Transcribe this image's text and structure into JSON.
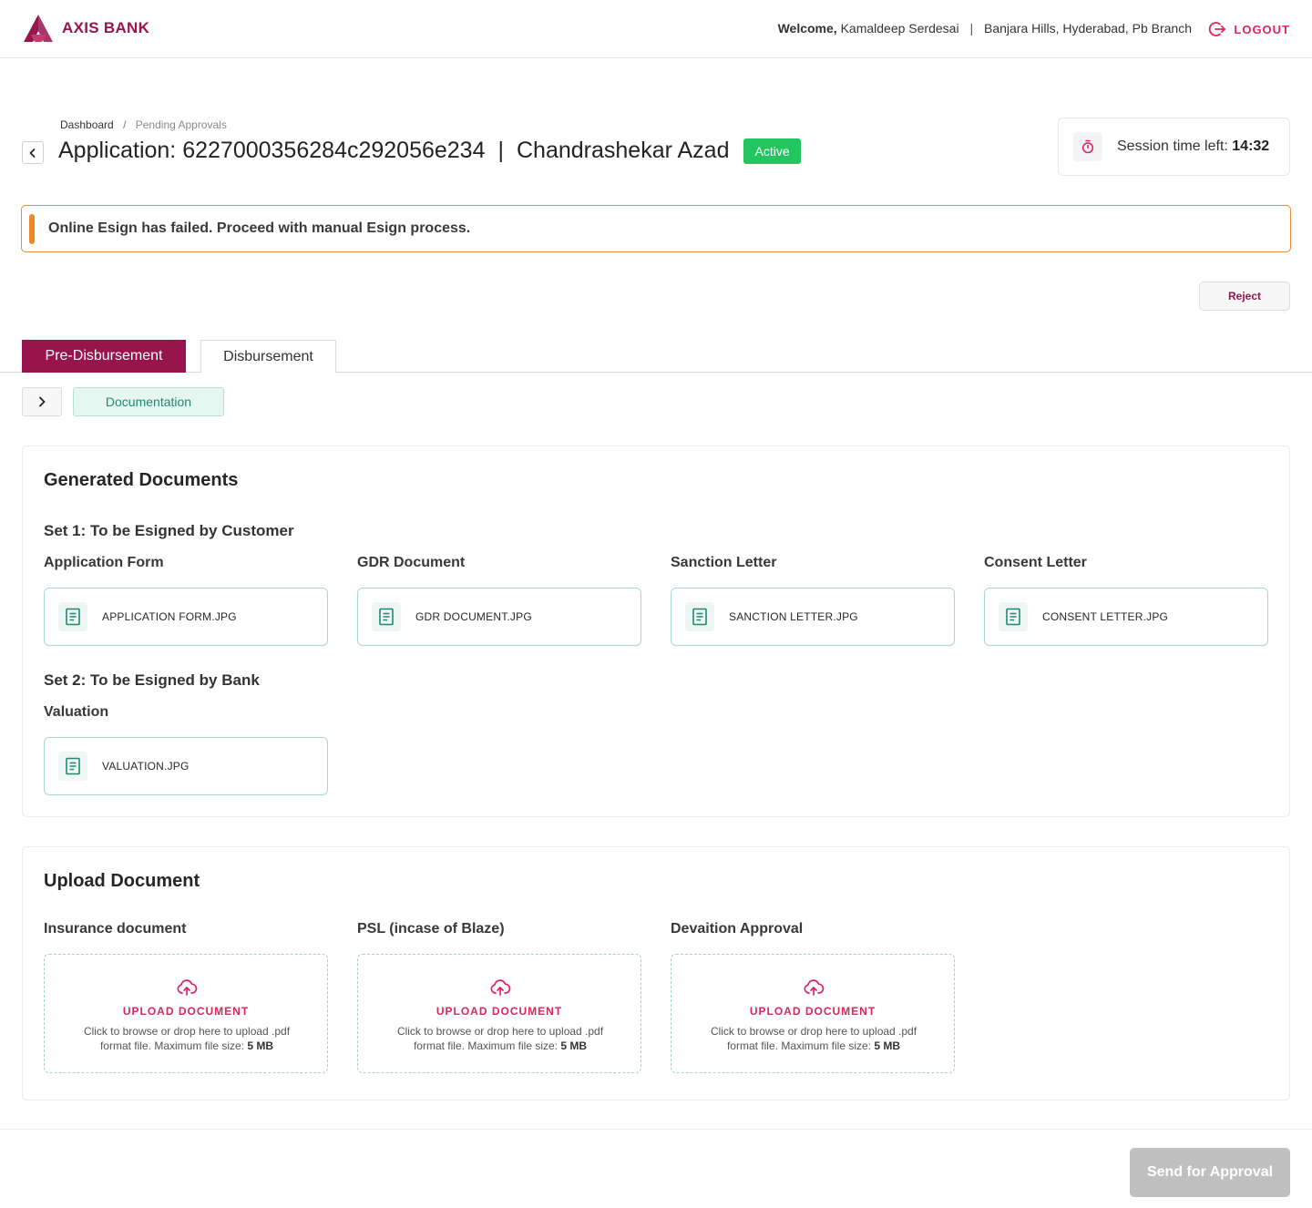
{
  "header": {
    "brand": "AXIS BANK",
    "welcome_label": "Welcome,",
    "user_name": "Kamaldeep Serdesai",
    "branch": "Banjara Hills, Hyderabad, Pb Branch",
    "logout_label": "LOGOUT"
  },
  "breadcrumb": {
    "root": "Dashboard",
    "separator": "/",
    "current": "Pending Approvals"
  },
  "application": {
    "prefix": "Application:",
    "id": "6227000356284c292056e234",
    "separator": "|",
    "customer": "Chandrashekar Azad",
    "status": "Active"
  },
  "session": {
    "label": "Session time left:",
    "time": "14:32"
  },
  "alert": {
    "message": "Online Esign has failed. Proceed with manual Esign process."
  },
  "actions": {
    "reject": "Reject",
    "send_for_approval": "Send for Approval"
  },
  "tabs": [
    {
      "label": "Pre-Disbursement",
      "active": true
    },
    {
      "label": "Disbursement",
      "active": false
    }
  ],
  "step": {
    "label": "Documentation"
  },
  "generated": {
    "title": "Generated Documents",
    "set1": {
      "title": "Set 1: To be Esigned by Customer",
      "docs": [
        {
          "label": "Application Form",
          "file": "APPLICATION FORM.JPG"
        },
        {
          "label": "GDR Document",
          "file": "GDR DOCUMENT.JPG"
        },
        {
          "label": "Sanction Letter",
          "file": "SANCTION LETTER.JPG"
        },
        {
          "label": "Consent Letter",
          "file": "CONSENT LETTER.JPG"
        }
      ]
    },
    "set2": {
      "title": "Set 2: To be Esigned by Bank",
      "docs": [
        {
          "label": "Valuation",
          "file": "VALUATION.JPG"
        }
      ]
    }
  },
  "upload": {
    "title": "Upload Document",
    "action_label": "UPLOAD DOCUMENT",
    "hint": "Click to browse or drop here to upload .pdf format file. Maximum file size:",
    "max_size": "5 MB",
    "items": [
      {
        "label": "Insurance document"
      },
      {
        "label": "PSL (incase of Blaze)"
      },
      {
        "label": "Devaition Approval"
      }
    ]
  },
  "colors": {
    "brand": "#97144d",
    "accent_pink": "#e0245e",
    "success": "#22c55e",
    "warning": "#f0882a",
    "teal": "#1f8a70"
  }
}
